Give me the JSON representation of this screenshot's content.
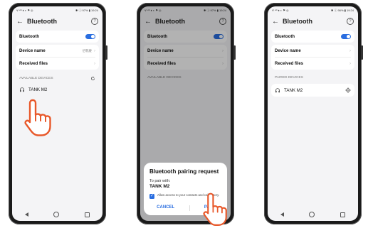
{
  "status_bar": {
    "left": "ᵃᵢˡ ⁴ᴳ ♦ ◐ ⚑ ◎",
    "right": "✱ ⓘ 97% ▮ 19:24"
  },
  "phones": [
    {
      "title": "Bluetooth",
      "bluetooth_label": "Bluetooth",
      "bluetooth_on": true,
      "device_name_label": "Device name",
      "device_name_value": "佰戰慶",
      "received_files_label": "Received files",
      "section_label": "AVAILABLE DEVICES",
      "device": "TANK M2"
    },
    {
      "title": "Bluetooth",
      "bluetooth_label": "Bluetooth",
      "device_name_label": "Device name",
      "received_files_label": "Received files",
      "section_label": "AVAILABLE DEVICES",
      "dialog": {
        "title": "Bluetooth pairing request",
        "subtitle": "To pair with:",
        "device": "TANK M2",
        "checkbox_text": "Allow access to your contacts and call history.",
        "cancel": "CANCEL",
        "pair": "PAIR"
      }
    },
    {
      "title": "Bluetooth",
      "bluetooth_label": "Bluetooth",
      "bluetooth_on": true,
      "status_right": "✱ ⓘ 96% ▮ 19:24",
      "device_name_label": "Device name",
      "received_files_label": "Received files",
      "section_label": "PAIRED DEVICES",
      "device": "TANK M2"
    }
  ],
  "colors": {
    "accent": "#2a6ee0",
    "hand_fill": "#ffffff",
    "hand_stroke": "#e8582a"
  }
}
